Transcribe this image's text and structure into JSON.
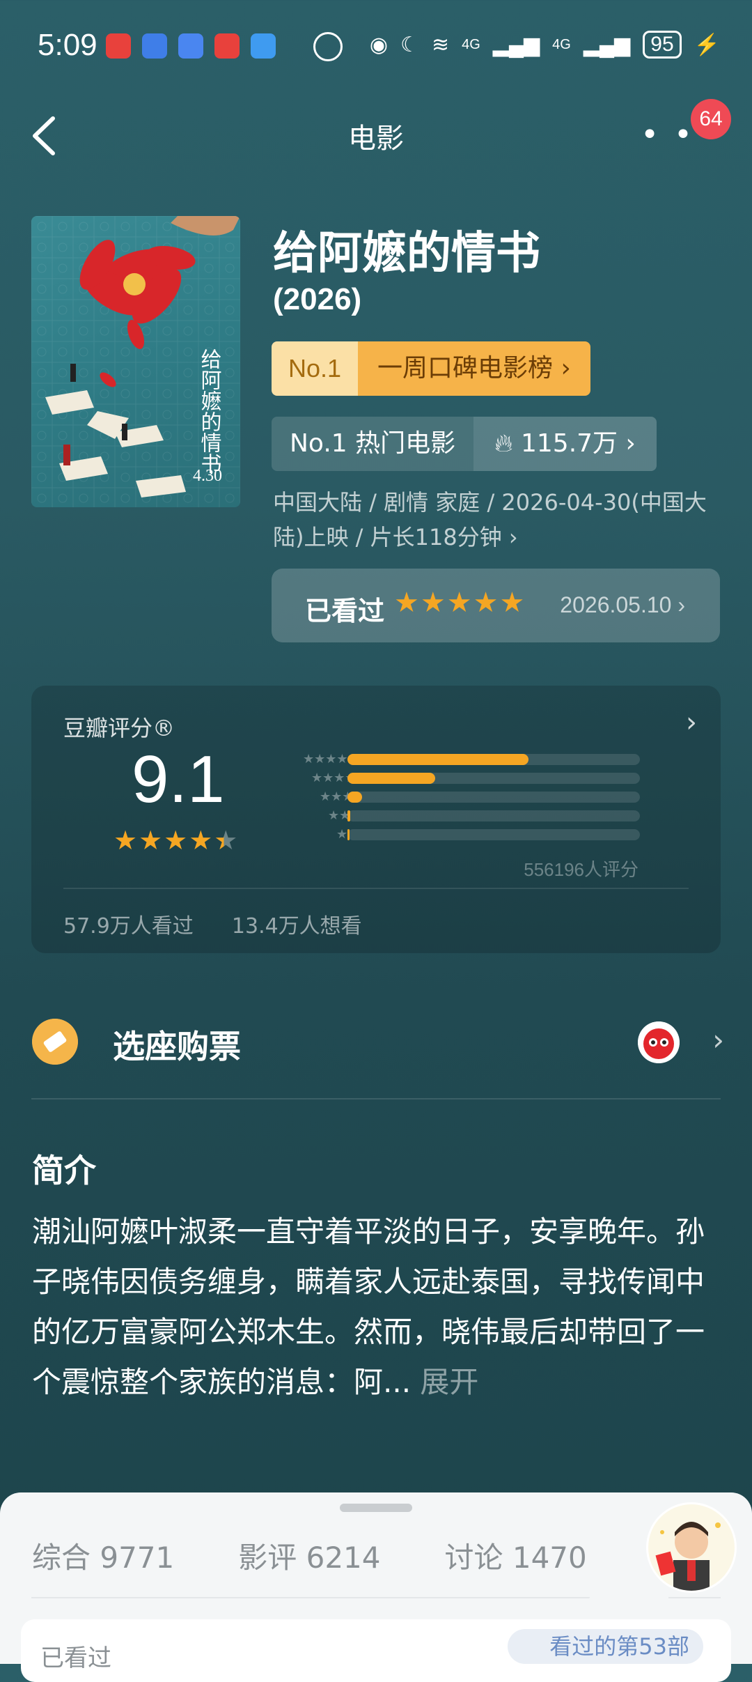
{
  "status_bar": {
    "time": "5:09",
    "notification_icons": [
      "huawei-store-icon",
      "shield-app-icon",
      "clock-app-icon",
      "huawei-store-icon",
      "message-app-icon"
    ],
    "signal_labels": [
      "4G",
      "4G"
    ],
    "battery": "95"
  },
  "header": {
    "title": "电影",
    "notification_count": "64"
  },
  "movie": {
    "title": "给阿嬷的情书",
    "year": "(2026)",
    "rank_week": {
      "number": "No.1",
      "label": "一周口碑电影榜 ›"
    },
    "rank_hot": {
      "label": "No.1 热门电影",
      "heat": "115.7万 ›"
    },
    "meta": "中国大陆 / 剧情 家庭 / 2026-04-30(中国大陆)上映 / 片长118分钟 ›",
    "watched": {
      "label": "已看过",
      "stars": "★★★★★",
      "date": "2026.05.10 ›"
    }
  },
  "rating": {
    "label": "豆瓣评分®",
    "score": "9.1",
    "stars": "★★★★★",
    "distribution": [
      {
        "stars": "★★★★★",
        "percent": 62
      },
      {
        "stars": "★★★★",
        "percent": 30
      },
      {
        "stars": "★★★",
        "percent": 5
      },
      {
        "stars": "★★",
        "percent": 1
      },
      {
        "stars": "★",
        "percent": 0.5
      }
    ],
    "raters": "556196人评分",
    "watched_count": "57.9万人看过",
    "want_count": "13.4万人想看"
  },
  "tickets": {
    "label": "选座购票"
  },
  "intro": {
    "heading": "简介",
    "text": "潮汕阿嬷叶淑柔一直守着平淡的日子，安享晚年。孙子晓伟因债务缠身，瞒着家人远赴泰国，寻找传闻中的亿万富豪阿公郑木生。然而，晓伟最后却带回了一个震惊整个家族的消息：阿...",
    "expand": "展开"
  },
  "bottom_sheet": {
    "tabs": [
      "综合 9771",
      "影评 6214",
      "讨论 1470"
    ],
    "partial_left": "已看过",
    "partial_right": "看过的第53部"
  },
  "colors": {
    "accent": "#f5a623",
    "badge": "#ef4a55",
    "background": "#2b5f68"
  }
}
